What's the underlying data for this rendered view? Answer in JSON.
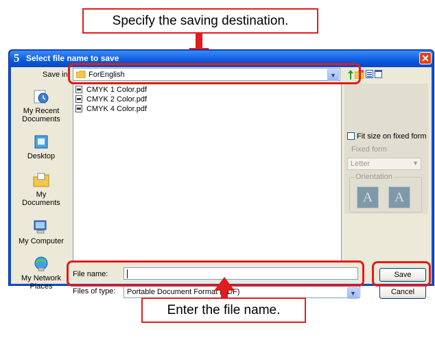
{
  "callouts": {
    "top": "Specify the saving destination.",
    "bottom": "Enter the file name."
  },
  "dialog": {
    "title": "Select file name to save",
    "save_in_label": "Save in:",
    "save_in_value": "ForEnglish",
    "files": [
      "CMYK 1 Color.pdf",
      "CMYK 2 Color.pdf",
      "CMYK 4 Color.pdf"
    ],
    "places": [
      "My Recent Documents",
      "Desktop",
      "My Documents",
      "My Computer",
      "My Network Places"
    ],
    "fit_size_label": "Fit size on fixed form",
    "fixed_form_label": "Fixed form",
    "fixed_form_value": "Letter",
    "orientation_label": "Orientation",
    "file_name_label": "File name:",
    "file_name_value": "",
    "files_of_type_label": "Files of type:",
    "files_of_type_value": "Portable Document Format (PDF)",
    "save_button": "Save",
    "cancel_button": "Cancel"
  },
  "colors": {
    "callout_red": "#e21b1b",
    "titlebar_blue": "#0a5adf",
    "dialog_face": "#ece9d8"
  }
}
